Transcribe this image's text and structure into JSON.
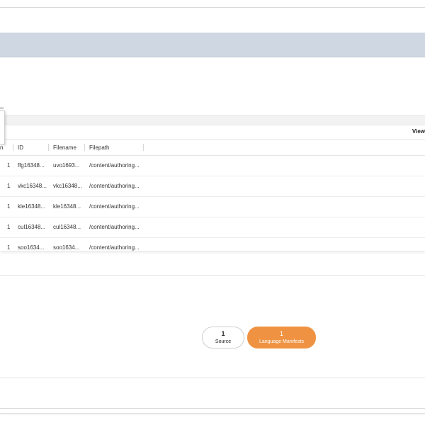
{
  "table": {
    "view_label": "View",
    "columns": [
      "n",
      "ID",
      "Filename",
      "Filepath"
    ],
    "rows": [
      {
        "num": "1",
        "id": "ffg16348...",
        "filename": "uvo1693...",
        "filepath": "/content/authoring..."
      },
      {
        "num": "1",
        "id": "vkc16348...",
        "filename": "vkc16348...",
        "filepath": "/content/authoring..."
      },
      {
        "num": "1",
        "id": "kle16348...",
        "filename": "kle16348...",
        "filepath": "/content/authoring..."
      },
      {
        "num": "1",
        "id": "cul16348...",
        "filename": "cul16348...",
        "filepath": "/content/authoring..."
      },
      {
        "num": "1",
        "id": "soo1634...",
        "filename": "soo1634...",
        "filepath": "/content/authoring..."
      }
    ]
  },
  "summary": {
    "source": {
      "count": "1",
      "label": "Source"
    },
    "language_manifests": {
      "count": "1",
      "label": "Language Manifests"
    }
  },
  "colors": {
    "accent": "#ef9342",
    "header_bar": "#cfd7e3"
  }
}
